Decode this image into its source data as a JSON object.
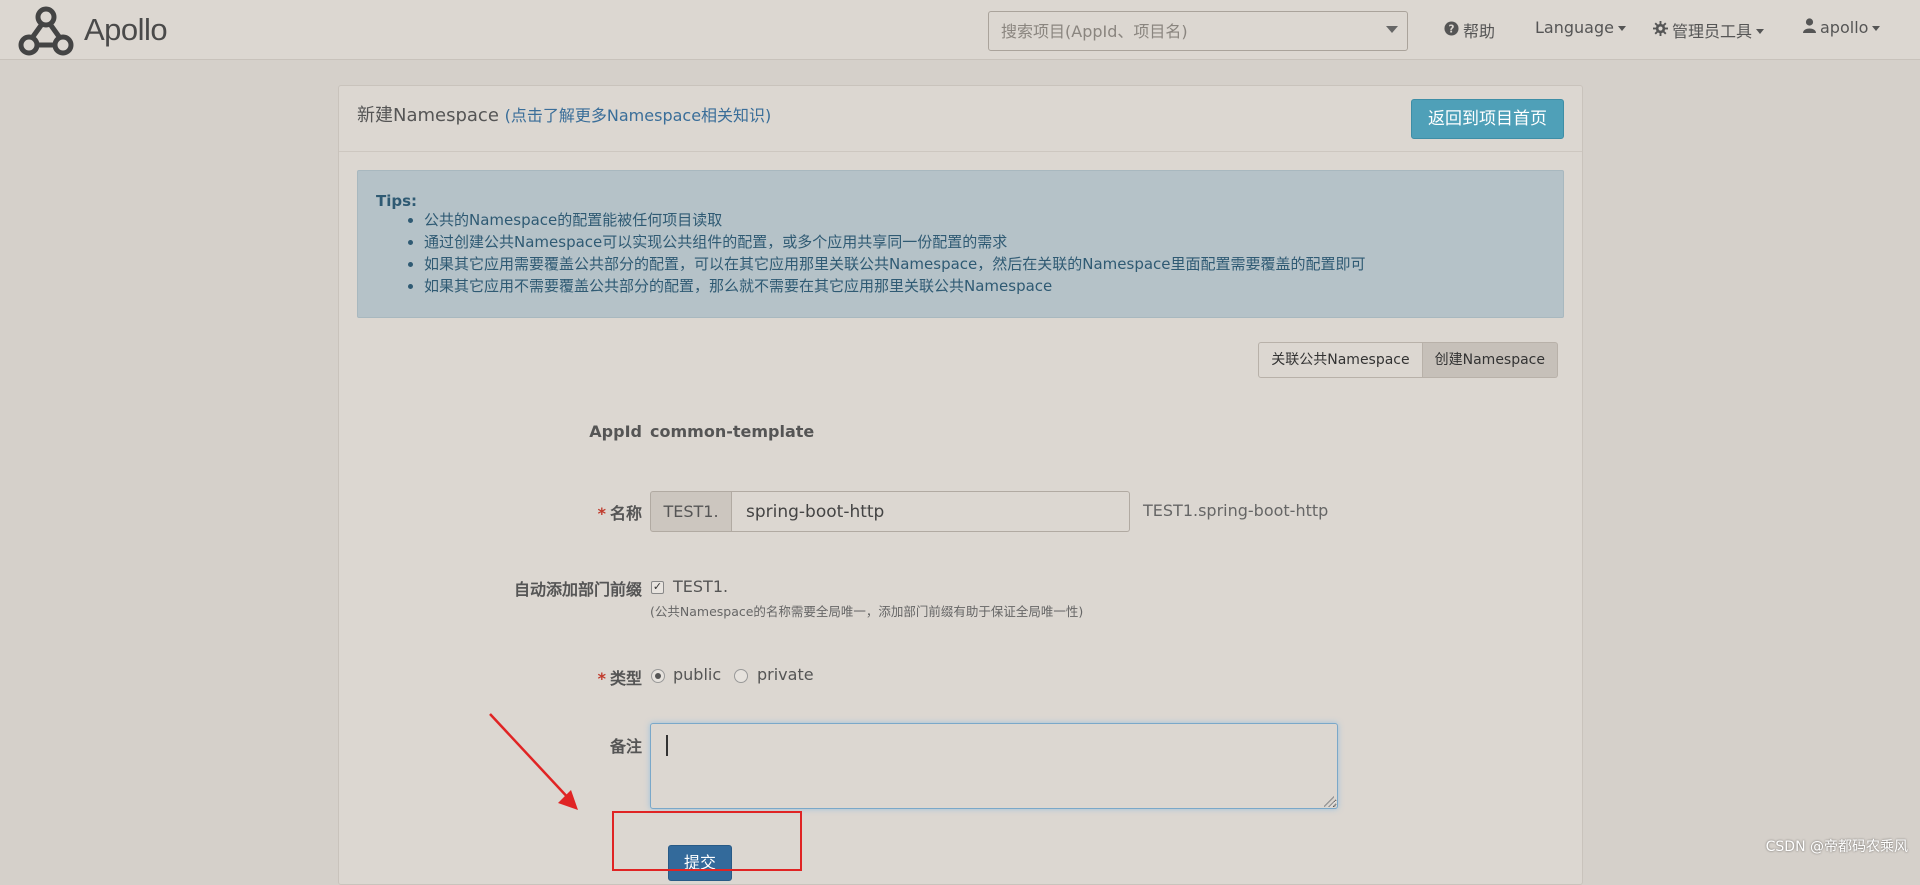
{
  "app": {
    "name": "Apollo"
  },
  "navbar": {
    "search": {
      "placeholder": "搜索项目(AppId、项目名)"
    },
    "help": "帮助",
    "language": "Language",
    "admin_tools": "管理员工具",
    "user": "apollo"
  },
  "panel": {
    "title": "新建Namespace",
    "learn_more": "(点击了解更多Namespace相关知识)",
    "back_button": "返回到项目首页"
  },
  "tips": {
    "title": "Tips:",
    "items": [
      "公共的Namespace的配置能被任何项目读取",
      "通过创建公共Namespace可以实现公共组件的配置，或多个应用共享同一份配置的需求",
      "如果其它应用需要覆盖公共部分的配置，可以在其它应用那里关联公共Namespace，然后在关联的Namespace里面配置需要覆盖的配置即可",
      "如果其它应用不需要覆盖公共部分的配置，那么就不需要在其它应用那里关联公共Namespace"
    ]
  },
  "toggle": {
    "link_public": "关联公共Namespace",
    "create": "创建Namespace"
  },
  "form": {
    "appid_label": "AppId",
    "appid_value": "common-template",
    "name_label": "名称",
    "name_prefix": "TEST1.",
    "name_value": "spring-boot-http",
    "name_preview": "TEST1.spring-boot-http",
    "prefix_label": "自动添加部门前缀",
    "prefix_checkbox_label": "TEST1.",
    "prefix_checked": true,
    "prefix_help": "(公共Namespace的名称需要全局唯一，添加部门前缀有助于保证全局唯一性)",
    "type_label": "类型",
    "type_options": [
      "public",
      "private"
    ],
    "type_selected": "public",
    "comment_label": "备注",
    "comment_value": "",
    "submit": "提交"
  },
  "required_mark": "*",
  "watermark": "CSDN @帝都码农乘风"
}
